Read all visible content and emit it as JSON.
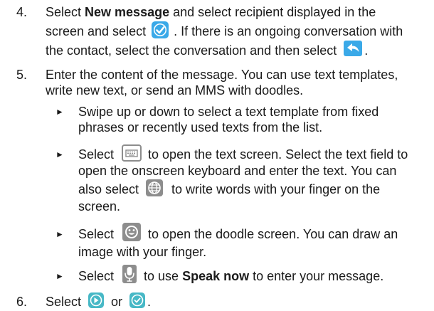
{
  "steps": [
    {
      "number": "4.",
      "l1_a": "Select ",
      "l1_bold": "New message",
      "l1_b": " and select recipient displayed in the",
      "l2_a": "screen and select ",
      "l2_b": ". If there is an ongoing conversation with",
      "l3_a": "the contact, select the conversation and then select ",
      "l3_b": "."
    },
    {
      "number": "5.",
      "l1": "Enter the content of the message. You can use text templates,",
      "l2": "write new text, or send an MMS with doodles.",
      "bullets": [
        {
          "marker": "►",
          "l1": "Swipe up or down to select a text template from fixed",
          "l2": "phrases or recently used texts from the list."
        },
        {
          "marker": "►",
          "l1_a": "Select ",
          "l1_b": " to open the text screen. Select the text field to",
          "l2": "open the onscreen keyboard and enter the text. You can",
          "l3_a": "also select ",
          "l3_b": " to write words with your finger on the",
          "l4": "screen."
        },
        {
          "marker": "►",
          "l1_a": "Select ",
          "l1_b": " to open the doodle screen. You can draw an",
          "l2": "image with your finger."
        },
        {
          "marker": "►",
          "l1_a": "Select ",
          "l1_b": " to use ",
          "l1_bold": "Speak now",
          "l1_c": " to enter your message."
        }
      ]
    },
    {
      "number": "6.",
      "l1_a": "Select ",
      "l1_b": " or ",
      "l1_c": "."
    }
  ],
  "icons": {
    "checkmark": "checkmark-icon",
    "reply": "reply-arrow-icon",
    "keyboard": "keyboard-icon",
    "globe": "globe-icon",
    "smiley": "smiley-icon",
    "microphone": "microphone-icon",
    "send_sms": "send-arrow-icon",
    "send_mms": "send-check-icon"
  },
  "colors": {
    "icon_blue": "#3aa9e8",
    "icon_grey": "#8d8d8d",
    "icon_teal": "#47b8c6"
  }
}
